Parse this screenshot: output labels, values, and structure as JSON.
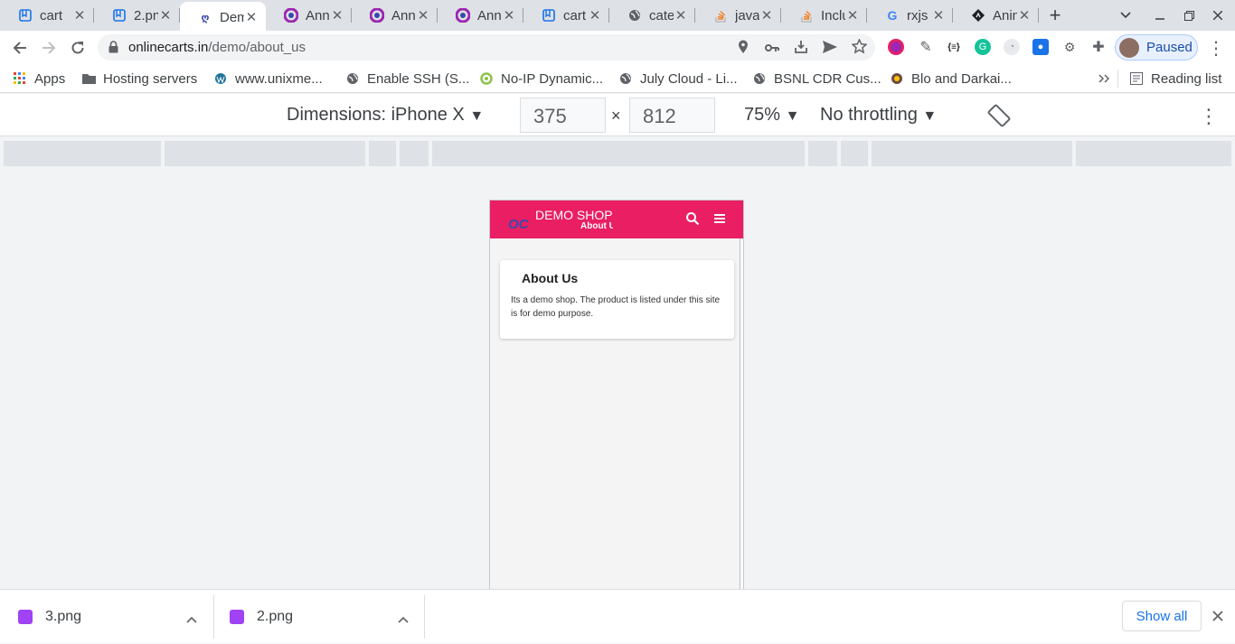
{
  "tabs": [
    {
      "title": "cart",
      "icon": "bookmark-icon",
      "color": "#1a73e8"
    },
    {
      "title": "2.pn",
      "icon": "bookmark-icon",
      "color": "#1a73e8"
    },
    {
      "title": "Dem",
      "icon": "site-icon",
      "color": "#3949ab",
      "active": true
    },
    {
      "title": "Ann",
      "icon": "chrome-color-icon",
      "color": "#9c27b0"
    },
    {
      "title": "Ann",
      "icon": "chrome-color-icon",
      "color": "#9c27b0"
    },
    {
      "title": "Ann",
      "icon": "chrome-color-icon",
      "color": "#9c27b0"
    },
    {
      "title": "cart",
      "icon": "bookmark-icon",
      "color": "#1a73e8"
    },
    {
      "title": "cate",
      "icon": "globe-icon",
      "color": "#5f6368"
    },
    {
      "title": "java",
      "icon": "stackoverflow-icon",
      "color": "#f48024"
    },
    {
      "title": "Inclu",
      "icon": "stackoverflow-icon",
      "color": "#f48024"
    },
    {
      "title": "rxjs",
      "icon": "google-icon",
      "color": "#4285f4"
    },
    {
      "title": "Anin",
      "icon": "diamond-icon",
      "color": "#202124"
    }
  ],
  "toolbar": {
    "url_host": "onlinecarts.in",
    "url_path": "/demo/about_us",
    "profile_label": "Paused"
  },
  "bookmarks": [
    {
      "label": "Apps",
      "icon": "apps-grid-icon"
    },
    {
      "label": "Hosting servers",
      "icon": "folder-icon"
    },
    {
      "label": "www.unixme...",
      "icon": "site-icon"
    },
    {
      "label": "Enable SSH (S...",
      "icon": "globe-icon"
    },
    {
      "label": "No-IP Dynamic...",
      "icon": "noip-icon"
    },
    {
      "label": "July Cloud - Li...",
      "icon": "globe-icon"
    },
    {
      "label": "BSNL CDR Cus...",
      "icon": "globe-icon"
    },
    {
      "label": "Blo and Darkai...",
      "icon": "site-icon"
    }
  ],
  "reading_list": "Reading list",
  "devtools": {
    "dimensions_label": "Dimensions: iPhone X",
    "width": "375",
    "height": "812",
    "times": "×",
    "zoom": "75%",
    "throttling": "No throttling"
  },
  "app": {
    "logo": "OC",
    "shop_name": "DEMO SHOP",
    "subtitle": "About Us",
    "card_title": "About Us",
    "card_text": "Its a demo shop. The product is listed under this site is for demo purpose.",
    "brand_color": "#e91e63"
  },
  "downloads": [
    {
      "name": "3.png"
    },
    {
      "name": "2.png"
    }
  ],
  "show_all": "Show all"
}
